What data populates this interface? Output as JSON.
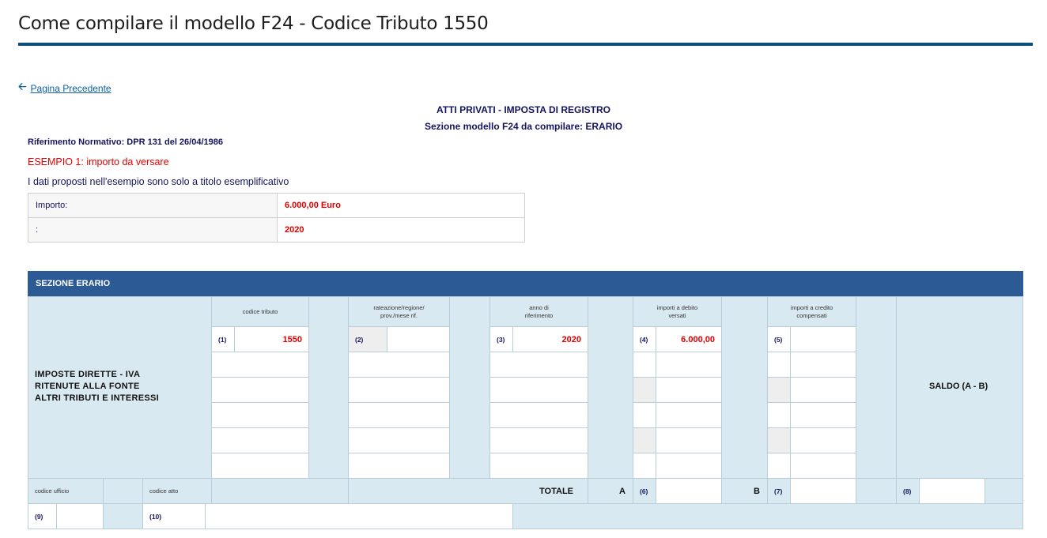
{
  "page": {
    "title": "Come compilare il modello F24 - Codice Tributo 1550",
    "back_label": "Pagina Precedente"
  },
  "header": {
    "line1": "ATTI PRIVATI - IMPOSTA DI REGISTRO",
    "line2": "Sezione modello F24 da compilare: ERARIO",
    "riferimento": "Riferimento Normativo: DPR  131 del 26/04/1986",
    "esempio": "ESEMPIO 1: importo da versare",
    "nota": "I dati proposti nell'esempio sono solo a titolo esemplificativo"
  },
  "info_rows": [
    {
      "label": "Importo:",
      "value": "6.000,00 Euro"
    },
    {
      "label": ":",
      "value": "2020"
    }
  ],
  "erario": {
    "heading": "SEZIONE ERARIO",
    "col_codice": "codice tributo",
    "col_rateazione_1": "rateazione/regione/",
    "col_rateazione_2": "prov./mese rif.",
    "col_anno_1": "anno di",
    "col_anno_2": "riferimento",
    "col_debito_1": "importi a debito",
    "col_debito_2": "versati",
    "col_credito_1": "importi a credito",
    "col_credito_2": "compensati",
    "n1": "(1)",
    "codice_tributo": "1550",
    "n2": "(2)",
    "n3": "(3)",
    "anno": "2020",
    "n4": "(4)",
    "importo_debito": "6.000,00",
    "n5": "(5)",
    "imposte_1": "IMPOSTE DIRETTE - IVA",
    "imposte_2": "RITENUTE ALLA FONTE",
    "imposte_3": "ALTRI TRIBUTI E INTERESSI",
    "saldo": "SALDO (A - B)",
    "codice_ufficio": "codice ufficio",
    "codice_atto": "codice atto",
    "totale": "TOTALE",
    "a": "A",
    "n6": "(6)",
    "b": "B",
    "n7": "(7)",
    "n8": "(8)",
    "n9": "(9)",
    "n10": "(10)"
  }
}
